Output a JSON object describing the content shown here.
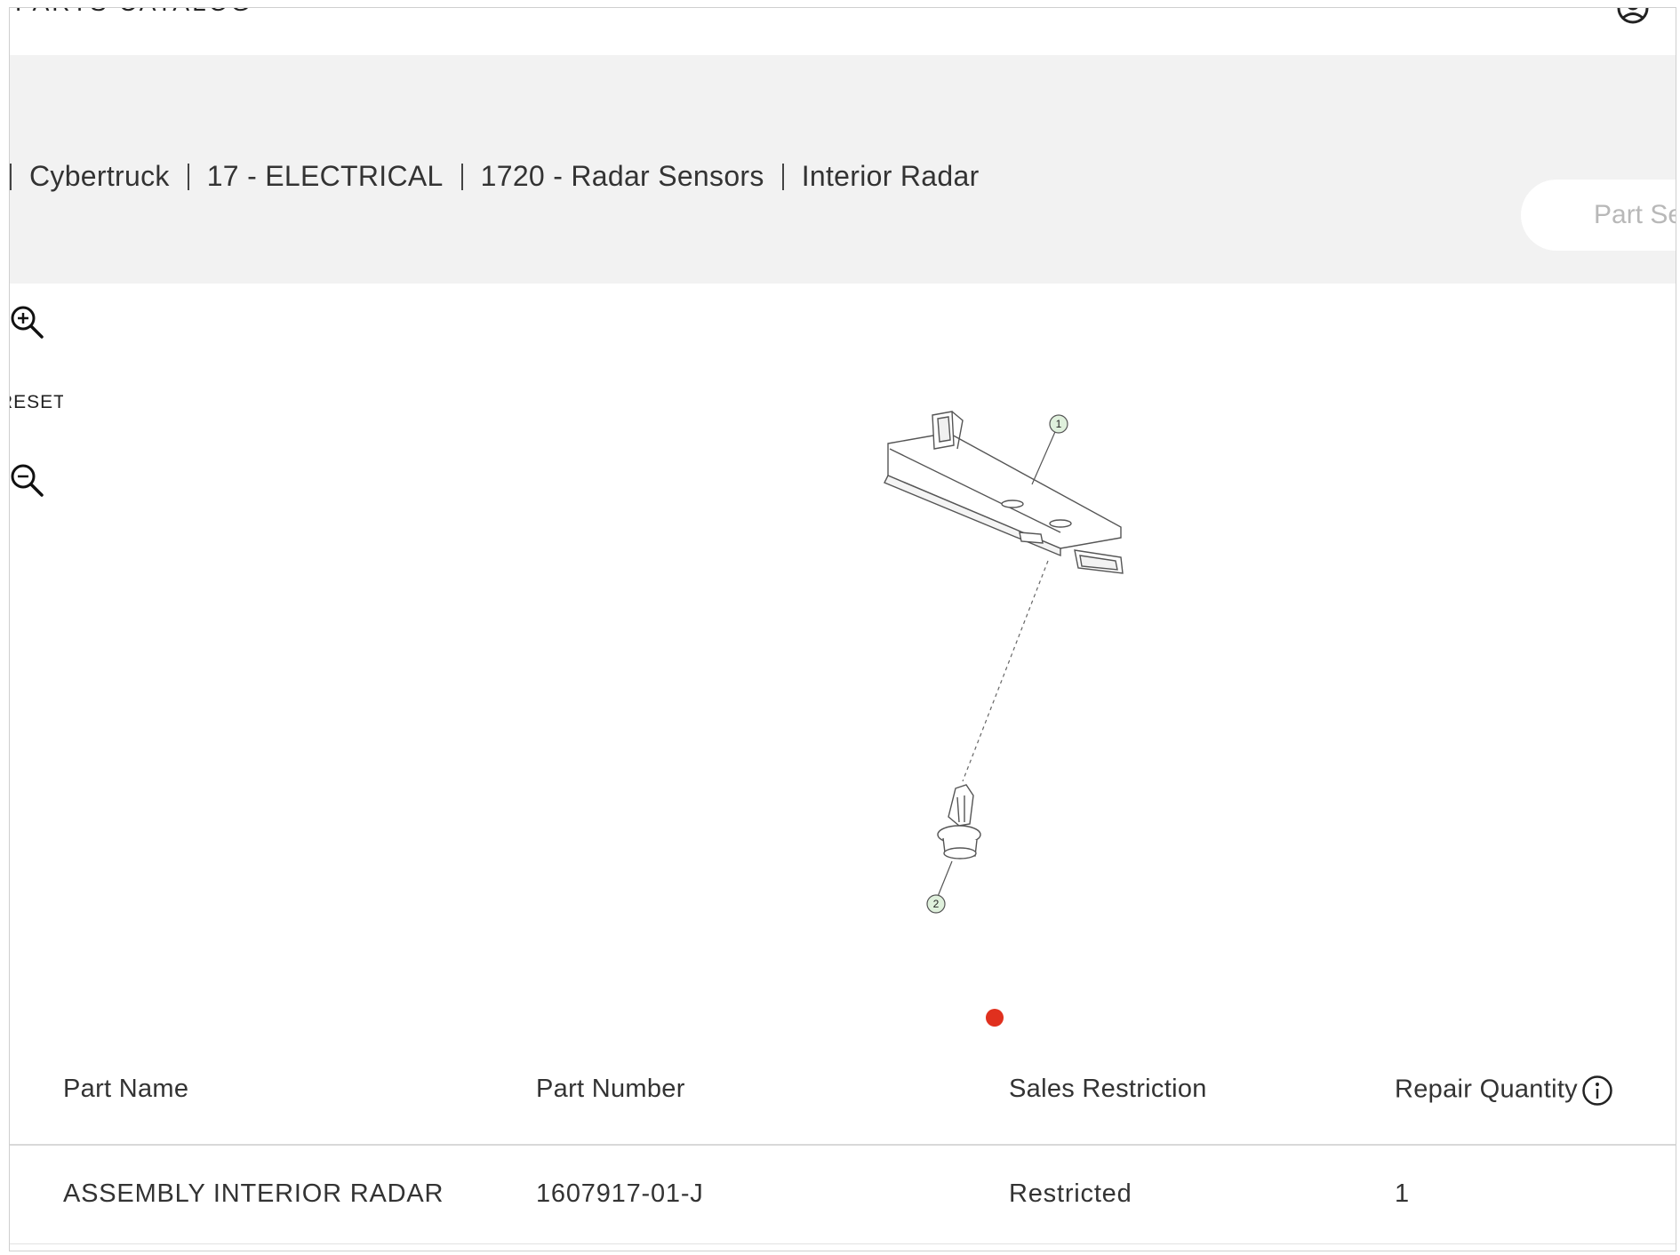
{
  "header": {
    "app_title": "PARTS CATALOG"
  },
  "breadcrumb": {
    "items": [
      "Cybertruck",
      "17 - ELECTRICAL",
      "1720 - Radar Sensors",
      "Interior Radar"
    ]
  },
  "search": {
    "placeholder": "Part Search"
  },
  "viewer": {
    "reset_label": "RESET",
    "callouts": [
      "1",
      "2"
    ],
    "carousel_active_color": "#e0301e"
  },
  "table": {
    "headers": {
      "part_name": "Part Name",
      "part_number": "Part Number",
      "sales_restriction": "Sales Restriction",
      "repair_quantity": "Repair Quantity"
    },
    "rows": [
      {
        "part_name": "ASSEMBLY INTERIOR RADAR",
        "part_number": "1607917-01-J",
        "sales_restriction": "Restricted",
        "repair_quantity": "1"
      }
    ]
  },
  "icons": [
    "account-icon",
    "zoom-in-icon",
    "zoom-out-icon",
    "info-icon"
  ],
  "colors": {
    "band": "#f2f2f2",
    "accent": "#e0301e",
    "callout_fill": "#dff0dc"
  }
}
